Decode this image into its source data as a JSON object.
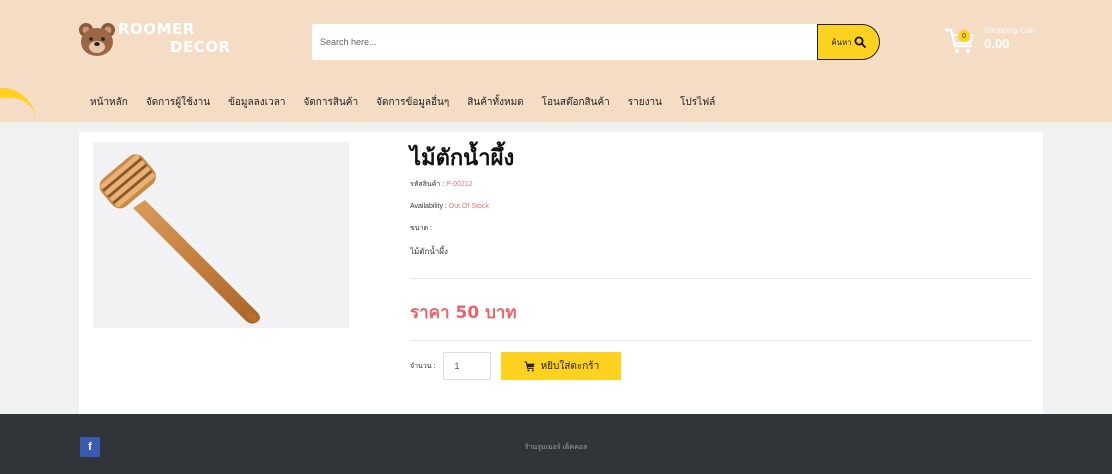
{
  "brand": {
    "line1": "ROOMER",
    "line2": "DECOR"
  },
  "search": {
    "placeholder": "Search here...",
    "button_label": "ค้นหา"
  },
  "cart": {
    "badge": "0",
    "label": "Shopping Cart",
    "total": "0.00"
  },
  "nav": {
    "items": [
      {
        "label": "หน้าหลัก"
      },
      {
        "label": "จัดการผู้ใช้งาน"
      },
      {
        "label": "ข้อมูลลงเวลา"
      },
      {
        "label": "จัดการสินค้า"
      },
      {
        "label": "จัดการข้อมูลอื่นๆ"
      },
      {
        "label": "สินค้าทั้งหมด"
      },
      {
        "label": "โอนสต๊อกสินค้า"
      },
      {
        "label": "รายงาน"
      },
      {
        "label": "โปรไฟล์"
      }
    ]
  },
  "product": {
    "title": "ไม้ตักน้ำผึ้ง",
    "code_label": "รหัสสินค้า :",
    "code_value": "P-00212",
    "availability_label": "Availability :",
    "availability_value": "Out Of Stock",
    "size_label": "ขนาด :",
    "size_value": "",
    "description": "ไม้ตักน้ำผึ้ง",
    "price": "ราคา 50 บาท"
  },
  "purchase": {
    "qty_label": "จำนวน :",
    "qty_value": "1",
    "add_label": "หยิบใส่ตะกร้า"
  },
  "footer": {
    "copyright": "ร้านรูมเมอร์ เด็คคอล"
  },
  "colors": {
    "header_bg": "#f5dcc5",
    "accent": "#ffd21f",
    "price": "#e9636a",
    "footer_bg": "#31353a",
    "facebook": "#3b5bb2"
  }
}
